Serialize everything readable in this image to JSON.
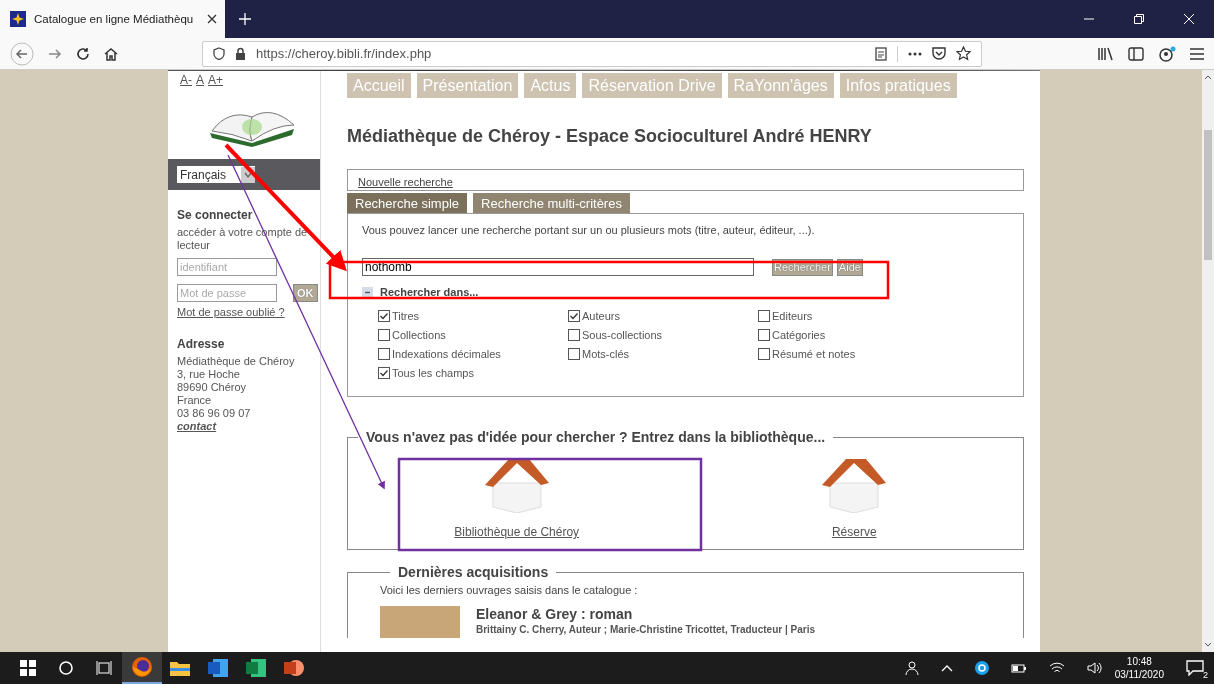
{
  "browser": {
    "tab_title": "Catalogue en ligne Médiathèqu",
    "url": "https://cheroy.bibli.fr/index.php"
  },
  "font_size_links": [
    "A-",
    "A",
    "A+"
  ],
  "nav": [
    "Accueil",
    "Présentation",
    "Actus",
    "Réservation Drive",
    "RaYonn'âges",
    "Infos pratiques"
  ],
  "title": "Médiathèque de Chéroy - Espace Socioculturel André HENRY",
  "language": {
    "value": "Français"
  },
  "login": {
    "heading": "Se connecter",
    "text": "accéder à votre compte de lecteur",
    "user_placeholder": "identifiant",
    "password_placeholder": "Mot de passe",
    "button": "OK",
    "forgot": "Mot de passe oublié ?"
  },
  "address": {
    "heading": "Adresse",
    "lines": [
      "Médiathèque de Chéroy",
      "3, rue Hoche",
      "89690 Chéroy",
      "France",
      "03 86 96 09 07"
    ],
    "contact": "contact"
  },
  "search": {
    "new_search": "Nouvelle recherche",
    "tabs": [
      {
        "label": "Recherche simple",
        "selected": true
      },
      {
        "label": "Recherche multi-critères",
        "selected": false
      }
    ],
    "hint": "Vous pouvez lancer une recherche portant sur un ou plusieurs mots (titre, auteur, éditeur, ...).",
    "query": "nothomb",
    "buttons": [
      "Rechercher",
      "Aide"
    ],
    "scope": {
      "label": "Rechercher dans...",
      "expanded": true,
      "options": [
        {
          "label": "Titres",
          "checked": true
        },
        {
          "label": "Auteurs",
          "checked": true
        },
        {
          "label": "Editeurs",
          "checked": false
        },
        {
          "label": "Collections",
          "checked": false
        },
        {
          "label": "Sous-collections",
          "checked": false
        },
        {
          "label": "Catégories",
          "checked": false
        },
        {
          "label": "Indexations décimales",
          "checked": false
        },
        {
          "label": "Mots-clés",
          "checked": false
        },
        {
          "label": "Résumé et notes",
          "checked": false
        },
        {
          "label": "Tous les champs",
          "checked": true
        }
      ]
    }
  },
  "browse": {
    "legend": "Vous n'avez pas d'idée pour chercher ? Entrez dans la bibliothèque...",
    "libraries": [
      "Bibliothèque de Chéroy",
      "Réserve"
    ]
  },
  "acquisitions": {
    "legend": "Dernières acquisitions",
    "intro": "Voici les derniers ouvrages saisis dans le catalogue :",
    "items": [
      {
        "title": "Eleanor & Grey : roman",
        "authors": "Brittainy C. Cherry, Auteur ; Marie-Christine Tricottet, Traducteur | Paris"
      }
    ]
  },
  "taskbar": {
    "time": "10:48",
    "date": "03/11/2020",
    "notifications": "2"
  }
}
